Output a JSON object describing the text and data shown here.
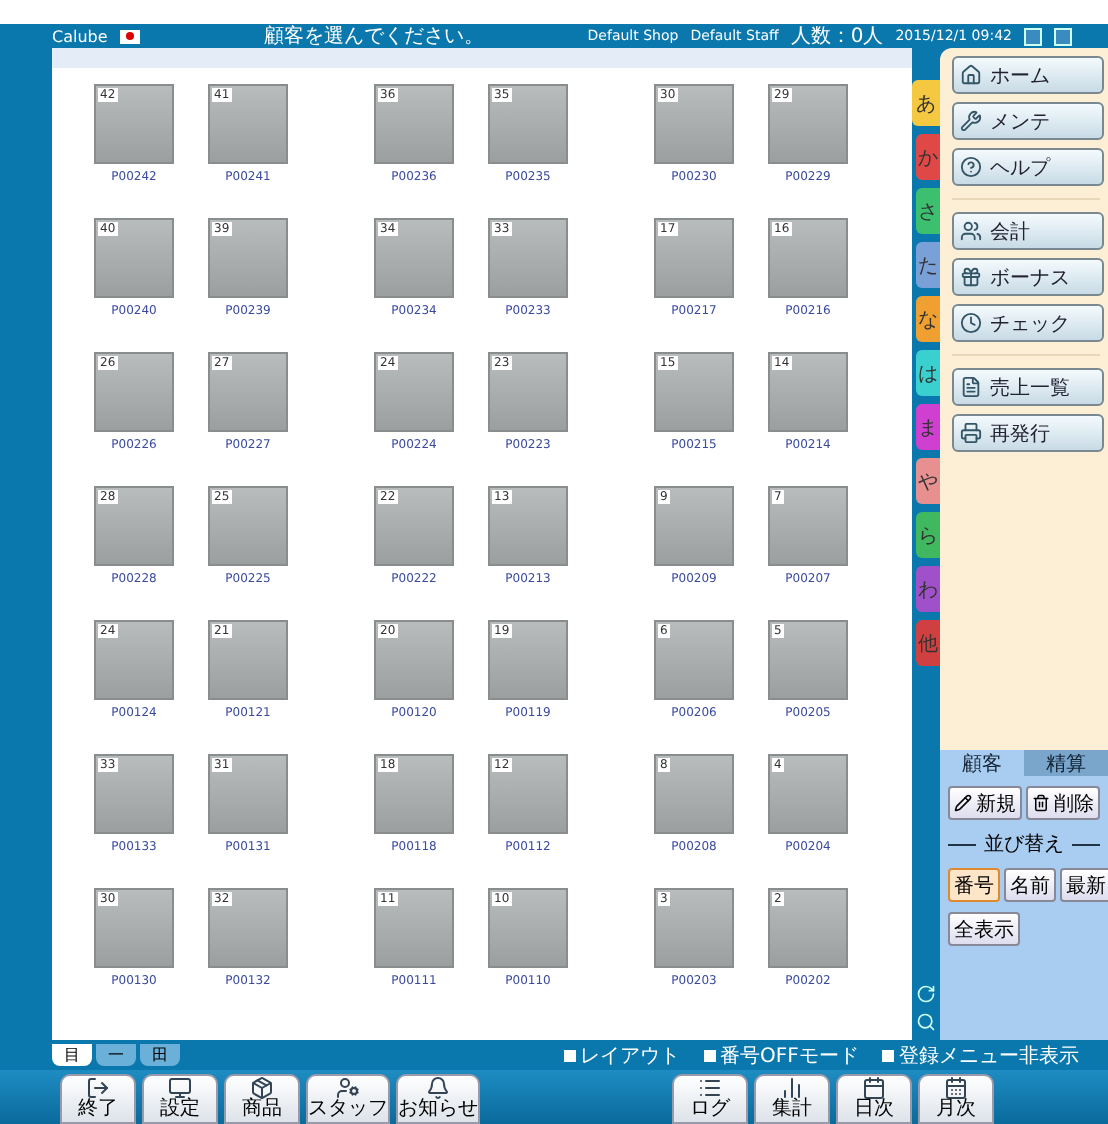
{
  "title_bar": {
    "app_name": "Calube",
    "message": "顧客を選んでください。",
    "shop": "Default Shop",
    "staff": "Default Staff",
    "count": "人数：0人",
    "datetime": "2015/12/1 09:42"
  },
  "tiles": [
    {
      "number": "42",
      "code": "P00242"
    },
    {
      "number": "41",
      "code": "P00241"
    },
    {
      "number": "36",
      "code": "P00236"
    },
    {
      "number": "35",
      "code": "P00235"
    },
    {
      "number": "30",
      "code": "P00230"
    },
    {
      "number": "29",
      "code": "P00229"
    },
    {
      "number": "40",
      "code": "P00240"
    },
    {
      "number": "39",
      "code": "P00239"
    },
    {
      "number": "34",
      "code": "P00234"
    },
    {
      "number": "33",
      "code": "P00233"
    },
    {
      "number": "17",
      "code": "P00217"
    },
    {
      "number": "16",
      "code": "P00216"
    },
    {
      "number": "26",
      "code": "P00226"
    },
    {
      "number": "27",
      "code": "P00227"
    },
    {
      "number": "24",
      "code": "P00224"
    },
    {
      "number": "23",
      "code": "P00223"
    },
    {
      "number": "15",
      "code": "P00215"
    },
    {
      "number": "14",
      "code": "P00214"
    },
    {
      "number": "28",
      "code": "P00228"
    },
    {
      "number": "25",
      "code": "P00225"
    },
    {
      "number": "22",
      "code": "P00222"
    },
    {
      "number": "13",
      "code": "P00213"
    },
    {
      "number": "9",
      "code": "P00209"
    },
    {
      "number": "7",
      "code": "P00207"
    },
    {
      "number": "24",
      "code": "P00124"
    },
    {
      "number": "21",
      "code": "P00121"
    },
    {
      "number": "20",
      "code": "P00120"
    },
    {
      "number": "19",
      "code": "P00119"
    },
    {
      "number": "6",
      "code": "P00206"
    },
    {
      "number": "5",
      "code": "P00205"
    },
    {
      "number": "33",
      "code": "P00133"
    },
    {
      "number": "31",
      "code": "P00131"
    },
    {
      "number": "18",
      "code": "P00118"
    },
    {
      "number": "12",
      "code": "P00112"
    },
    {
      "number": "8",
      "code": "P00208"
    },
    {
      "number": "4",
      "code": "P00204"
    },
    {
      "number": "30",
      "code": "P00130"
    },
    {
      "number": "32",
      "code": "P00132"
    },
    {
      "number": "11",
      "code": "P00111"
    },
    {
      "number": "10",
      "code": "P00110"
    },
    {
      "number": "3",
      "code": "P00203"
    },
    {
      "number": "2",
      "code": "P00202"
    }
  ],
  "view_tabs": [
    {
      "label": "目",
      "selected": true
    },
    {
      "label": "一",
      "selected": false
    },
    {
      "label": "田",
      "selected": false
    }
  ],
  "options": [
    {
      "label": "レイアウト",
      "checked": false
    },
    {
      "label": "番号OFFモード",
      "checked": false
    },
    {
      "label": "登録メニュー非表示",
      "checked": false
    }
  ],
  "index_tabs": [
    {
      "label": "あ",
      "color": "#f5c842",
      "selected": true
    },
    {
      "label": "か",
      "color": "#e04848",
      "selected": false
    },
    {
      "label": "さ",
      "color": "#3cc070",
      "selected": false
    },
    {
      "label": "た",
      "color": "#7aa0d8",
      "selected": false
    },
    {
      "label": "な",
      "color": "#f0a030",
      "selected": false
    },
    {
      "label": "は",
      "color": "#3ad0d0",
      "selected": false
    },
    {
      "label": "ま",
      "color": "#d040d0",
      "selected": false
    },
    {
      "label": "や",
      "color": "#e89090",
      "selected": false
    },
    {
      "label": "ら",
      "color": "#40b860",
      "selected": false
    },
    {
      "label": "わ",
      "color": "#a050c8",
      "selected": false
    },
    {
      "label": "他",
      "color": "#d04040",
      "selected": false
    }
  ],
  "menu_groups": [
    [
      "ホーム",
      "メンテ",
      "ヘルプ"
    ],
    [
      "会計",
      "ボーナス",
      "チェック"
    ],
    [
      "売上一覧",
      "再発行"
    ]
  ],
  "panel_tabs": [
    {
      "label": "顧客",
      "selected": true
    },
    {
      "label": "精算",
      "selected": false
    }
  ],
  "panel_actions": [
    "新規",
    "削除"
  ],
  "sort_label": "並び替え",
  "sort_options": [
    {
      "label": "番号",
      "selected": true
    },
    {
      "label": "名前",
      "selected": false
    },
    {
      "label": "最新",
      "selected": false
    }
  ],
  "all_button": "全表示",
  "toolbar_left": [
    "終了",
    "設定",
    "商品",
    "スタッフ",
    "お知らせ"
  ],
  "toolbar_right": [
    "ログ",
    "集計",
    "日次",
    "月次"
  ]
}
